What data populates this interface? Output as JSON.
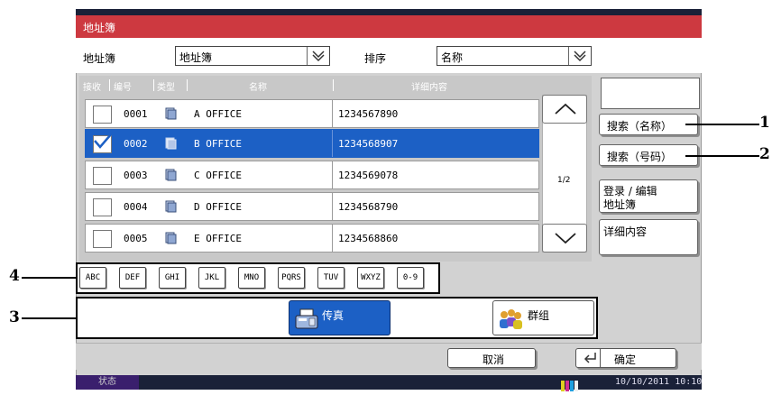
{
  "title": "地址簿",
  "header": {
    "addressbook_label": "地址簿",
    "addressbook_value": "地址簿",
    "sort_label": "排序",
    "sort_value": "名称"
  },
  "columns": [
    "接收",
    "编号",
    "类型",
    "名称",
    "详细内容"
  ],
  "rows": [
    {
      "num": "0001",
      "name": "A OFFICE",
      "detail": "1234567890",
      "checked": false
    },
    {
      "num": "0002",
      "name": "B OFFICE",
      "detail": "1234568907",
      "checked": true
    },
    {
      "num": "0003",
      "name": "C OFFICE",
      "detail": "1234569078",
      "checked": false
    },
    {
      "num": "0004",
      "name": "D OFFICE",
      "detail": "1234568790",
      "checked": false
    },
    {
      "num": "0005",
      "name": "E OFFICE",
      "detail": "1234568860",
      "checked": false
    }
  ],
  "page_indicator": "1/2",
  "side_buttons": {
    "search_name": "搜索（名称）",
    "search_number": "搜索（号码）",
    "register_line1": "登录 / 编辑",
    "register_line2": "地址簿",
    "details": "详细内容"
  },
  "keys": [
    "ABC",
    "DEF",
    "GHI",
    "JKL",
    "MNO",
    "PQRS",
    "TUV",
    "WXYZ",
    "0-9"
  ],
  "dest_buttons": {
    "fax": "传真",
    "group": "群组"
  },
  "bottom": {
    "cancel": "取消",
    "ok": "确定"
  },
  "status": {
    "label": "状态",
    "datetime": "10/10/2011  10:10"
  },
  "callouts": {
    "c1": "1",
    "c2": "2",
    "c3": "3",
    "c4": "4"
  },
  "colors": {
    "title_bar": "#cd3940",
    "selected": "#1c60c5",
    "status_bar": "#1a2138"
  },
  "icons": [
    "fax-type-icon",
    "chevron-down-icon",
    "chevron-up-icon",
    "enter-icon",
    "fax-icon",
    "group-icon",
    "toner-icon"
  ]
}
